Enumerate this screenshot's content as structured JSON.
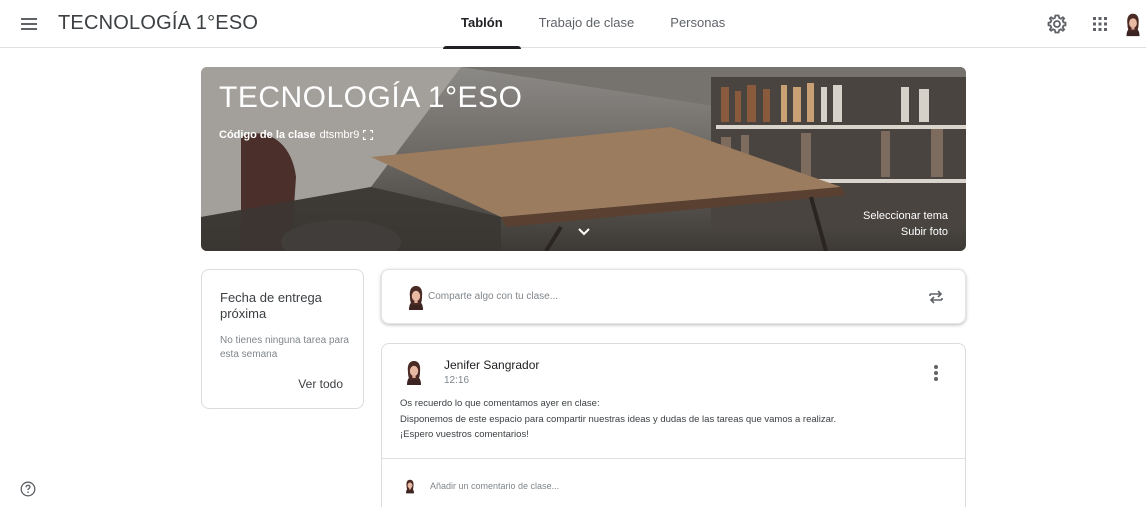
{
  "app": {
    "title": "TECNOLOGÍA 1°ESO"
  },
  "tabs": [
    {
      "label": "Tablón",
      "active": true
    },
    {
      "label": "Trabajo de clase",
      "active": false
    },
    {
      "label": "Personas",
      "active": false
    }
  ],
  "header_icons": [
    "menu-icon",
    "gear-icon",
    "apps-grid-icon",
    "profile-avatar"
  ],
  "banner": {
    "title": "TECNOLOGÍA 1°ESO",
    "code_label": "Código de la clase",
    "code_value": "dtsmbr9",
    "select_theme": "Seleccionar tema",
    "upload_photo": "Subir foto"
  },
  "upcoming": {
    "title": "Fecha de entrega próxima",
    "empty": "No tienes ninguna tarea para esta semana",
    "view_all": "Ver todo"
  },
  "share": {
    "placeholder": "Comparte algo con tu clase..."
  },
  "post": {
    "author": "Jenifer Sangrador",
    "time": "12:16",
    "lines": [
      "Os recuerdo lo que comentamos ayer en clase:",
      "Disponemos de este espacio para compartir nuestras ideas y dudas de las tareas que vamos a realizar.",
      "¡Espero vuestros comentarios!"
    ],
    "comment_placeholder": "Añadir un comentario de clase..."
  },
  "colors": {
    "accent": "#202124",
    "divider": "#e0e0e0",
    "muted": "#80868b"
  }
}
